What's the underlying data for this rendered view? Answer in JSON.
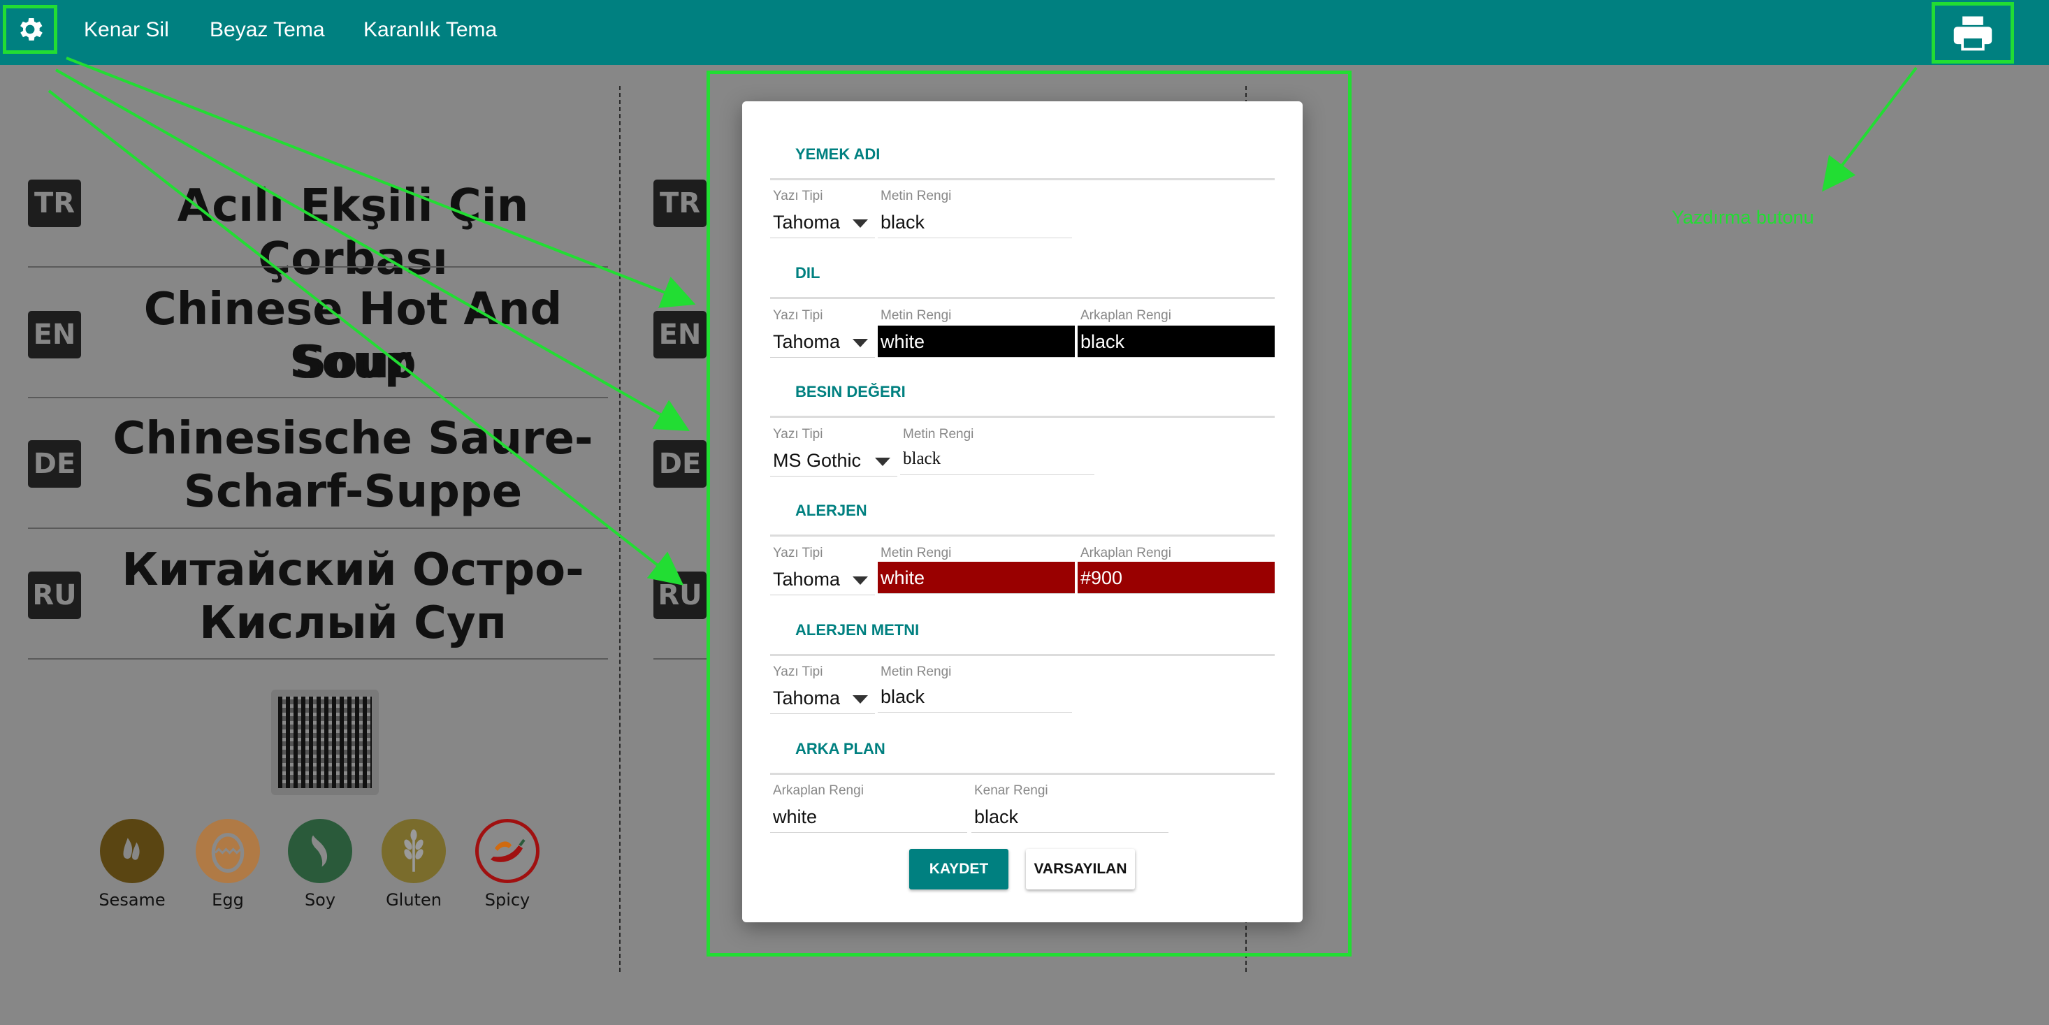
{
  "topbar": {
    "nav": [
      "Kenar Sil",
      "Beyaz Tema",
      "Karanlık Tema"
    ],
    "icons": {
      "settings": "gear-icon",
      "print": "printer-icon"
    }
  },
  "sheet": {
    "flags": [
      "TR",
      "EN",
      "DE",
      "RU"
    ],
    "titles": {
      "tr": "Acılı Ekşili Çin Çorbası",
      "en_1": "Chinese Hot And Sour",
      "en_2": "Soup",
      "de_1": "Chinesische Saure-",
      "de_2": "Scharf-Suppe",
      "ru_1": "Китайский Остро-",
      "ru_2": "Кислый Суп"
    },
    "allergens": [
      "Sesame",
      "Egg",
      "Soy",
      "Gluten",
      "Spicy"
    ],
    "allergen_colors": [
      "#5a4512",
      "#b07a45",
      "#2a5a3a",
      "#7a6c2c",
      "#a01010"
    ]
  },
  "modal": {
    "sections": [
      "YEMEK ADI",
      "DIL",
      "BESIN DEĞERI",
      "ALERJEN",
      "ALERJEN METNI",
      "ARKA PLAN"
    ],
    "labels": {
      "font": "Yazı Tipi",
      "text_color": "Metin Rengi",
      "bg_color": "Arkaplan Rengi",
      "border_color": "Kenar Rengi"
    },
    "yemek_adi": {
      "font": "Tahoma",
      "text_color": "black"
    },
    "dil": {
      "font": "Tahoma",
      "text_color": "white",
      "bg_color": "black"
    },
    "besin": {
      "font": "MS Gothic",
      "text_color": "black"
    },
    "alerjen": {
      "font": "Tahoma",
      "text_color": "white",
      "bg_color": "#900"
    },
    "alerjen_metni": {
      "font": "Tahoma",
      "text_color": "black"
    },
    "arka_plan": {
      "bg_color": "white",
      "border_color": "black"
    },
    "buttons": {
      "save": "KAYDET",
      "reset": "VARSAYILAN"
    }
  },
  "annotation": {
    "print_note": "Yazdırma butonu",
    "color": "#22dd33"
  },
  "colors": {
    "teal": "#008080",
    "dark_red": "#990000"
  }
}
